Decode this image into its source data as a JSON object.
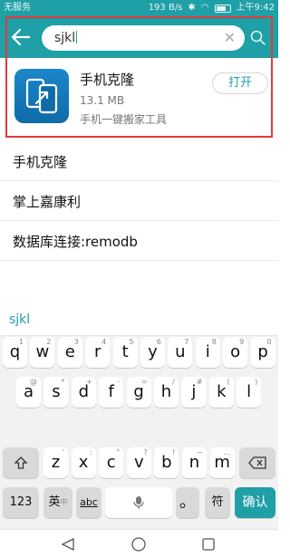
{
  "status": {
    "carrier": "无服务",
    "speed": "193 B/s",
    "time": "上午9:42"
  },
  "search": {
    "query": "sjkl"
  },
  "result": {
    "name": "手机克隆",
    "size": "13.1 MB",
    "desc": "手机一键搬家工具",
    "open_label": "打开"
  },
  "suggestions": [
    "手机克隆",
    "掌上嘉康利",
    "数据库连接:remodb"
  ],
  "keyboard": {
    "composing": "sjkl",
    "row1": [
      {
        "k": "q",
        "h": "1"
      },
      {
        "k": "w",
        "h": "2"
      },
      {
        "k": "e",
        "h": "3"
      },
      {
        "k": "r",
        "h": "4"
      },
      {
        "k": "t",
        "h": "5"
      },
      {
        "k": "y",
        "h": "6"
      },
      {
        "k": "u",
        "h": "7"
      },
      {
        "k": "i",
        "h": "8"
      },
      {
        "k": "o",
        "h": "9"
      },
      {
        "k": "p",
        "h": "0"
      }
    ],
    "row2": [
      {
        "k": "a",
        "h": "@"
      },
      {
        "k": "s",
        "h": "*"
      },
      {
        "k": "d",
        "h": "+"
      },
      {
        "k": "f",
        "h": "-"
      },
      {
        "k": "g",
        "h": "="
      },
      {
        "k": "h",
        "h": "/"
      },
      {
        "k": "j",
        "h": "#"
      },
      {
        "k": "k",
        "h": "("
      },
      {
        "k": "l",
        "h": ")"
      }
    ],
    "row3": [
      {
        "k": "z",
        "h": "'"
      },
      {
        "k": "x",
        "h": ":"
      },
      {
        "k": "c",
        "h": "\""
      },
      {
        "k": "v",
        "h": "?"
      },
      {
        "k": "b",
        "h": "!"
      },
      {
        "k": "n",
        "h": "~"
      },
      {
        "k": "m",
        "h": "…"
      }
    ],
    "bottom": {
      "num": "123",
      "lang": "英",
      "lang_hint": "中",
      "abc": "abc",
      "period": "。",
      "symbol": "符",
      "confirm": "确认"
    }
  },
  "colors": {
    "accent": "#1f9fa6",
    "highlight": "#e23a3a"
  }
}
